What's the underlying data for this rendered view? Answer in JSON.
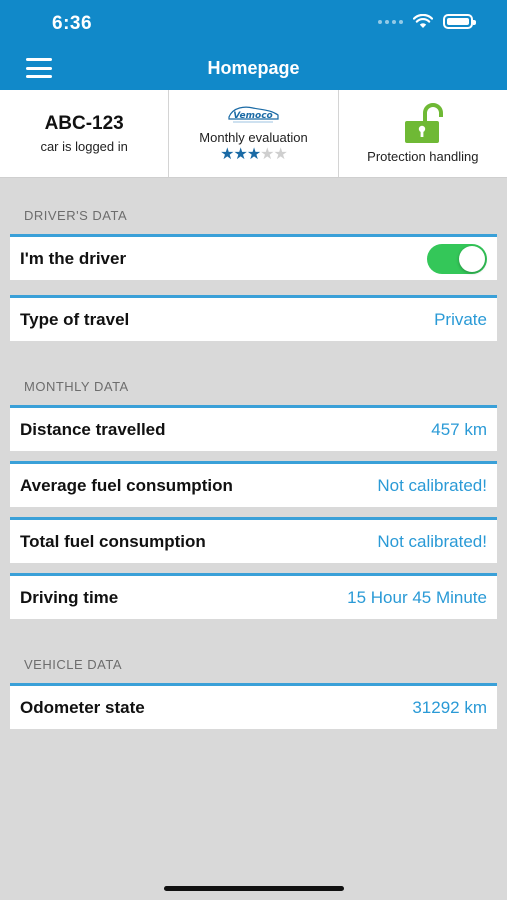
{
  "status_bar": {
    "time": "6:36"
  },
  "nav": {
    "title": "Homepage"
  },
  "header": {
    "plate": "ABC-123",
    "plate_status": "car is logged in",
    "evaluation_label": "Monthly evaluation",
    "evaluation_rating": 3,
    "evaluation_max": 5,
    "protection_label": "Protection handling",
    "lock_color": "#6fb935"
  },
  "sections": {
    "drivers": {
      "title": "DRIVER'S DATA",
      "driver_label": "I'm the driver",
      "driver_on": true,
      "travel_label": "Type of travel",
      "travel_value": "Private"
    },
    "monthly": {
      "title": "MONTHLY DATA",
      "rows": [
        {
          "label": "Distance travelled",
          "value": "457 km"
        },
        {
          "label": "Average fuel consumption",
          "value": "Not calibrated!"
        },
        {
          "label": "Total fuel consumption",
          "value": "Not calibrated!"
        },
        {
          "label": "Driving time",
          "value": "15 Hour 45 Minute"
        }
      ]
    },
    "vehicle": {
      "title": "VEHICLE DATA",
      "odometer_label": "Odometer state",
      "odometer_value": "31292 km"
    }
  },
  "colors": {
    "brand": "#1189c9",
    "accent_line": "#3aa0d8",
    "value_text": "#2a9ad6",
    "toggle_on": "#34c759"
  }
}
